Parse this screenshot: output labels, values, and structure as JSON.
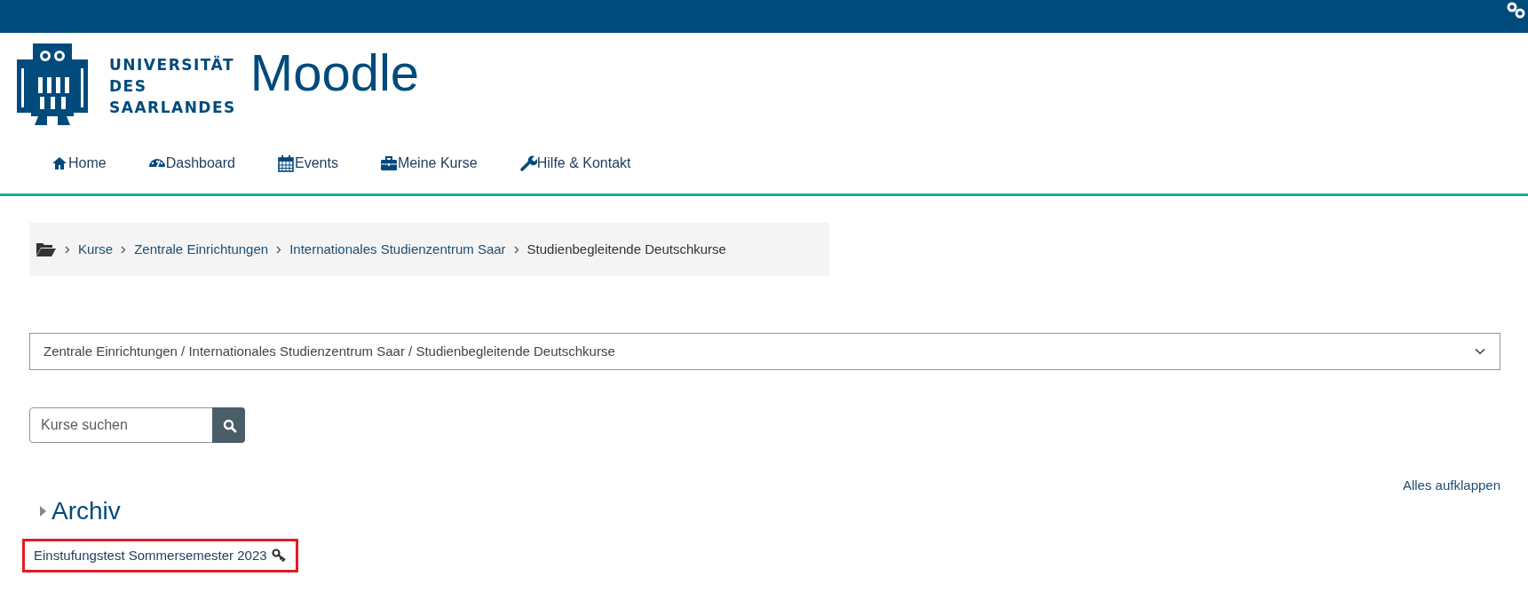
{
  "logo": {
    "lines": [
      "UNIVERSITÄT",
      "DES",
      "SAARLANDES"
    ]
  },
  "site_title": "Moodle",
  "nav": [
    {
      "label": "Home",
      "kind": "home"
    },
    {
      "label": "Dashboard",
      "kind": "dashboard"
    },
    {
      "label": "Events",
      "kind": "events"
    },
    {
      "label": "Meine Kurse",
      "kind": "courses"
    },
    {
      "label": "Hilfe & Kontakt",
      "kind": "help"
    }
  ],
  "breadcrumb": [
    {
      "label": "Kurse",
      "link": true
    },
    {
      "label": "Zentrale Einrichtungen",
      "link": true
    },
    {
      "label": "Internationales Studienzentrum Saar",
      "link": true
    },
    {
      "label": "Studienbegleitende Deutschkurse",
      "link": false
    }
  ],
  "category_select": {
    "value": "Zentrale Einrichtungen / Internationales Studienzentrum Saar / Studienbegleitende Deutschkurse"
  },
  "search": {
    "placeholder": "Kurse suchen"
  },
  "expand_all": "Alles aufklappen",
  "category": {
    "name": "Archiv",
    "expanded": false
  },
  "courses": [
    {
      "name": "Einstufungstest Sommersemester 2023",
      "self_enrol": true,
      "highlighted": true
    }
  ]
}
